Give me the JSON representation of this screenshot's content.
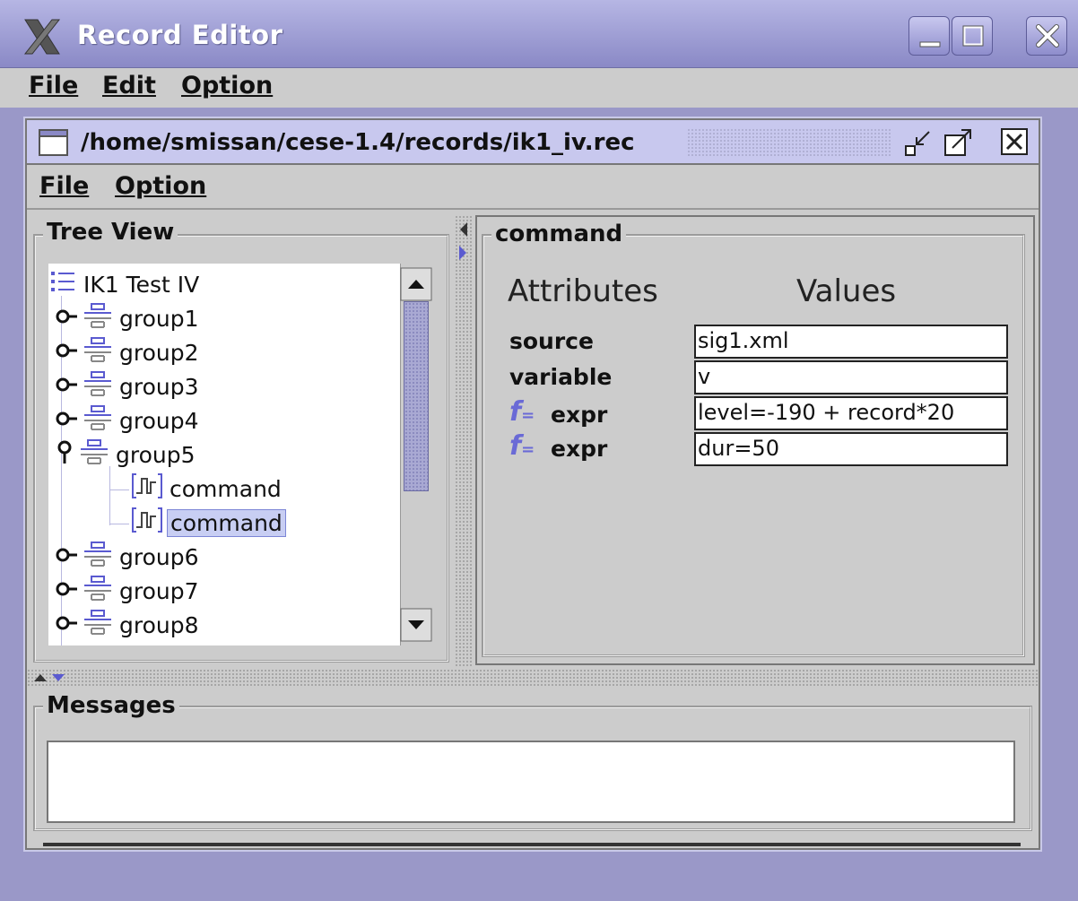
{
  "window": {
    "title": "Record Editor",
    "menu": [
      "File",
      "Edit",
      "Option"
    ]
  },
  "internal_frame": {
    "title": "/home/smissan/cese-1.4/records/ik1_iv.rec",
    "menu": [
      "File",
      "Option"
    ]
  },
  "tree": {
    "panel_label": "Tree View",
    "root": "IK1 Test IV",
    "items": [
      {
        "label": "group1",
        "type": "group",
        "expanded": false
      },
      {
        "label": "group2",
        "type": "group",
        "expanded": false
      },
      {
        "label": "group3",
        "type": "group",
        "expanded": false
      },
      {
        "label": "group4",
        "type": "group",
        "expanded": false
      },
      {
        "label": "group5",
        "type": "group",
        "expanded": true
      },
      {
        "label": "command",
        "type": "command",
        "selected": false
      },
      {
        "label": "command",
        "type": "command",
        "selected": true
      },
      {
        "label": "group6",
        "type": "group",
        "expanded": false
      },
      {
        "label": "group7",
        "type": "group",
        "expanded": false
      },
      {
        "label": "group8",
        "type": "group",
        "expanded": false
      }
    ]
  },
  "command_panel": {
    "label": "command",
    "attributes_header": "Attributes",
    "values_header": "Values",
    "rows": [
      {
        "name": "source",
        "value": "sig1.xml",
        "has_fx_icon": false
      },
      {
        "name": "variable",
        "value": "v",
        "has_fx_icon": false
      },
      {
        "name": "expr",
        "value": "level=-190 + record*20",
        "has_fx_icon": true
      },
      {
        "name": "expr",
        "value": "dur=50",
        "has_fx_icon": true
      }
    ]
  },
  "messages": {
    "label": "Messages",
    "text": ""
  },
  "colors": {
    "desktop": "#9a98c8",
    "titlebar": "#8a89c6",
    "selection": "#c8cef3",
    "fx_icon": "#6a6ad6"
  },
  "icons": {
    "app": "x-logo-icon",
    "frame": "window-frame-icon",
    "root": "list-icon",
    "group": "group-node-icon",
    "command": "pulse-command-icon",
    "expander": "key-expander-icon"
  }
}
